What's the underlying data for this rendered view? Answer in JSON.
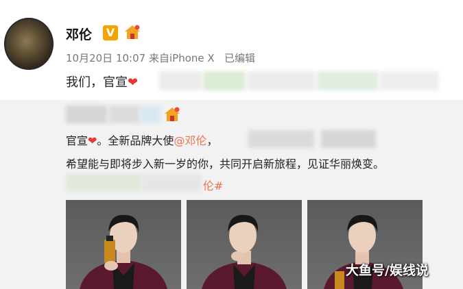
{
  "post": {
    "username": "邓伦",
    "vip_badge": "V",
    "date": "10月20日",
    "time": "10:07",
    "source_prefix": "来自",
    "source": "iPhone X",
    "edited": "已编辑",
    "text": "我们，官宣",
    "heart": "❤",
    "icons": [
      "avatar",
      "vip-badge-icon",
      "house-icon"
    ]
  },
  "retweet": {
    "line1_a": "官宣",
    "heart": "❤",
    "line1_b": "。全新品牌大使",
    "mention": "@邓伦",
    "line1_c": "，",
    "line2": "希望能与即将步入新一岁的你，共同开启新旅程，见证华丽焕变。",
    "line3_tail": "伦#",
    "photos": [
      "photo-1",
      "photo-2",
      "photo-3"
    ]
  },
  "watermark": "大鱼号/娱线说",
  "colors": {
    "link": "#eb7350",
    "heart": "#e53935",
    "vip": "#f6a200",
    "card_bg": "#f2f2f2"
  }
}
